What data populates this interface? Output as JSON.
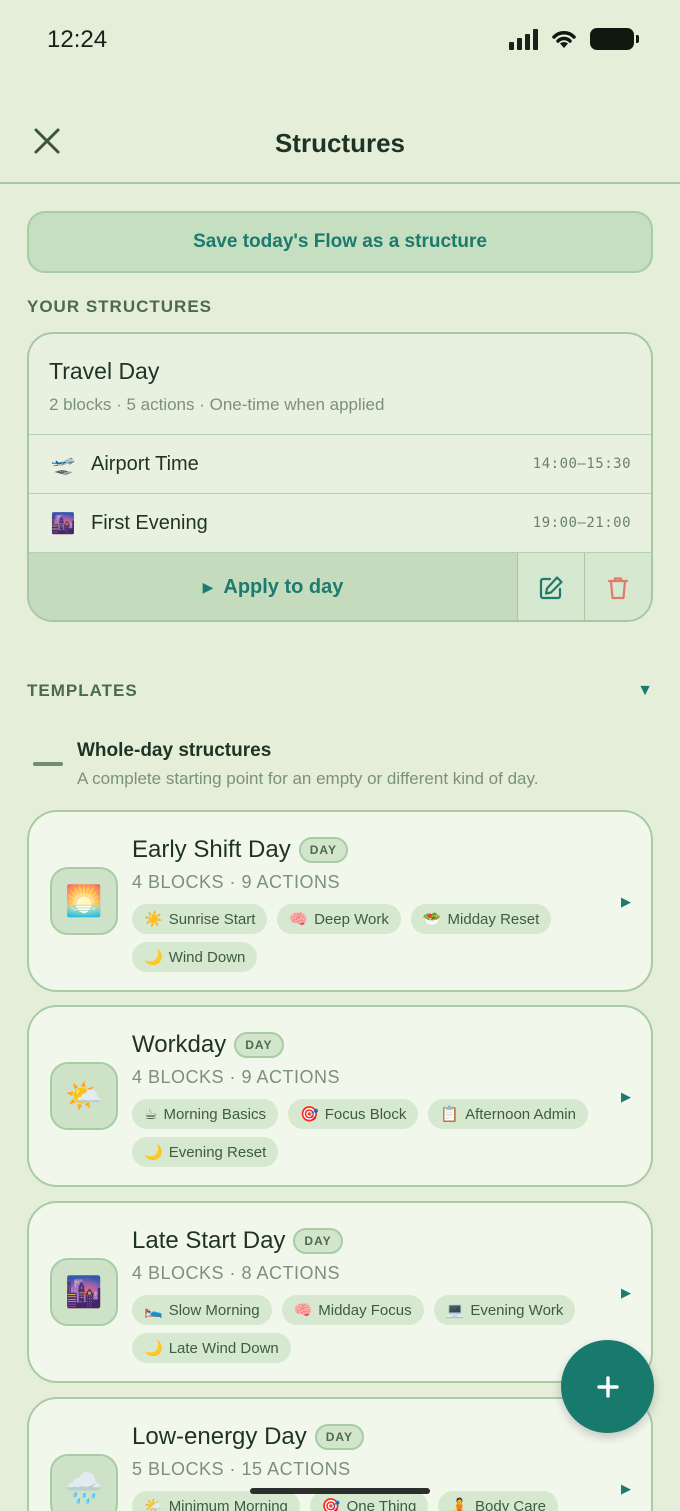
{
  "status_bar": {
    "time": "12:24"
  },
  "header": {
    "title": "Structures"
  },
  "save_button": {
    "label": "Save today's Flow as a structure"
  },
  "your_structures": {
    "label": "YOUR STRUCTURES",
    "card": {
      "name": "Travel Day",
      "meta": "2 blocks · 5 actions · One-time when applied",
      "rows": [
        {
          "icon": "🛫",
          "name": "Airport Time",
          "time": "14:00–15:30"
        },
        {
          "icon": "🌆",
          "name": "First Evening",
          "time": "19:00–21:00"
        }
      ],
      "apply_label": "Apply to day",
      "apply_arrow": "▶"
    }
  },
  "templates": {
    "label": "TEMPLATES",
    "toggle": "▼",
    "group": {
      "title": "Whole-day structures",
      "description": "A complete starting point for an empty or different kind of day."
    },
    "cards": [
      {
        "icon": "🌅",
        "name": "Early Shift Day",
        "badge": "DAY",
        "meta": "4 BLOCKS · 9 ACTIONS",
        "chips": [
          {
            "icon": "☀️",
            "label": "Sunrise Start"
          },
          {
            "icon": "🧠",
            "label": "Deep Work"
          },
          {
            "icon": "🥗",
            "label": "Midday Reset"
          },
          {
            "icon": "🌙",
            "label": "Wind Down"
          }
        ],
        "arrow": "▶"
      },
      {
        "icon": "🌤️",
        "name": "Workday",
        "badge": "DAY",
        "meta": "4 BLOCKS · 9 ACTIONS",
        "chips": [
          {
            "icon": "☕",
            "label": "Morning Basics"
          },
          {
            "icon": "🎯",
            "label": "Focus Block"
          },
          {
            "icon": "📋",
            "label": "Afternoon Admin"
          },
          {
            "icon": "🌙",
            "label": "Evening Reset"
          }
        ],
        "arrow": "▶"
      },
      {
        "icon": "🌆",
        "name": "Late Start Day",
        "badge": "DAY",
        "meta": "4 BLOCKS · 8 ACTIONS",
        "chips": [
          {
            "icon": "🛌",
            "label": "Slow Morning"
          },
          {
            "icon": "🧠",
            "label": "Midday Focus"
          },
          {
            "icon": "💻",
            "label": "Evening Work"
          },
          {
            "icon": "🌙",
            "label": "Late Wind Down"
          }
        ],
        "arrow": "▶"
      },
      {
        "icon": "🌧️",
        "name": "Low-energy Day",
        "badge": "DAY",
        "meta": "5 BLOCKS · 15 ACTIONS",
        "chips": [
          {
            "icon": "🌤️",
            "label": "Minimum Morning"
          },
          {
            "icon": "🎯",
            "label": "One Thing"
          },
          {
            "icon": "🧘",
            "label": "Body Care"
          }
        ],
        "arrow": "▶"
      }
    ]
  },
  "fab": {
    "label": "+"
  }
}
